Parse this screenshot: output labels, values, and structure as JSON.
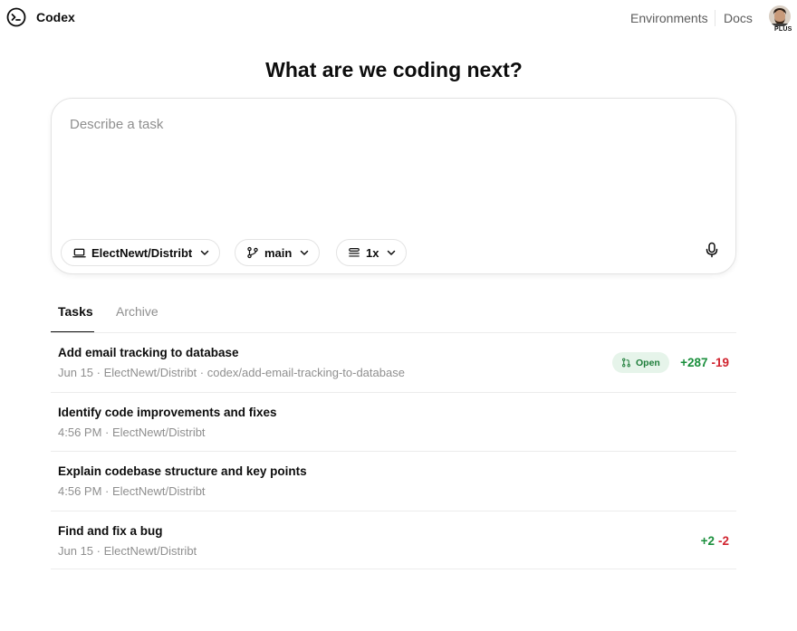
{
  "header": {
    "brand": "Codex",
    "nav": {
      "environments": "Environments",
      "docs": "Docs"
    },
    "plan_badge": "PLUS"
  },
  "main": {
    "title": "What are we coding next?"
  },
  "composer": {
    "placeholder": "Describe a task",
    "value": "",
    "repo_label": "ElectNewt/Distribt",
    "branch_label": "main",
    "runs_label": "1x"
  },
  "tabs": [
    {
      "label": "Tasks",
      "active": true
    },
    {
      "label": "Archive",
      "active": false
    }
  ],
  "tasks": [
    {
      "title": "Add email tracking to database",
      "meta": "Jun 15 · ElectNewt/Distribt · codex/add-email-tracking-to-database",
      "status": "Open",
      "additions": "+287",
      "deletions": "-19"
    },
    {
      "title": "Identify code improvements and fixes",
      "meta": "4:56 PM · ElectNewt/Distribt"
    },
    {
      "title": "Explain codebase structure and key points",
      "meta": "4:56 PM · ElectNewt/Distribt"
    },
    {
      "title": "Find and fix a bug",
      "meta": "Jun 15 · ElectNewt/Distribt",
      "additions": "+2",
      "deletions": "-2"
    }
  ],
  "colors": {
    "addition": "#1a8f3c",
    "deletion": "#d1242f",
    "status_open_bg": "#e6f4ea",
    "status_open_fg": "#1e7d3a"
  },
  "icons": {
    "logo": "terminal-prompt-icon",
    "repo": "laptop-icon",
    "branch": "git-branch-icon",
    "runs": "stack-icon",
    "mic": "microphone-icon",
    "status": "pull-request-icon"
  }
}
